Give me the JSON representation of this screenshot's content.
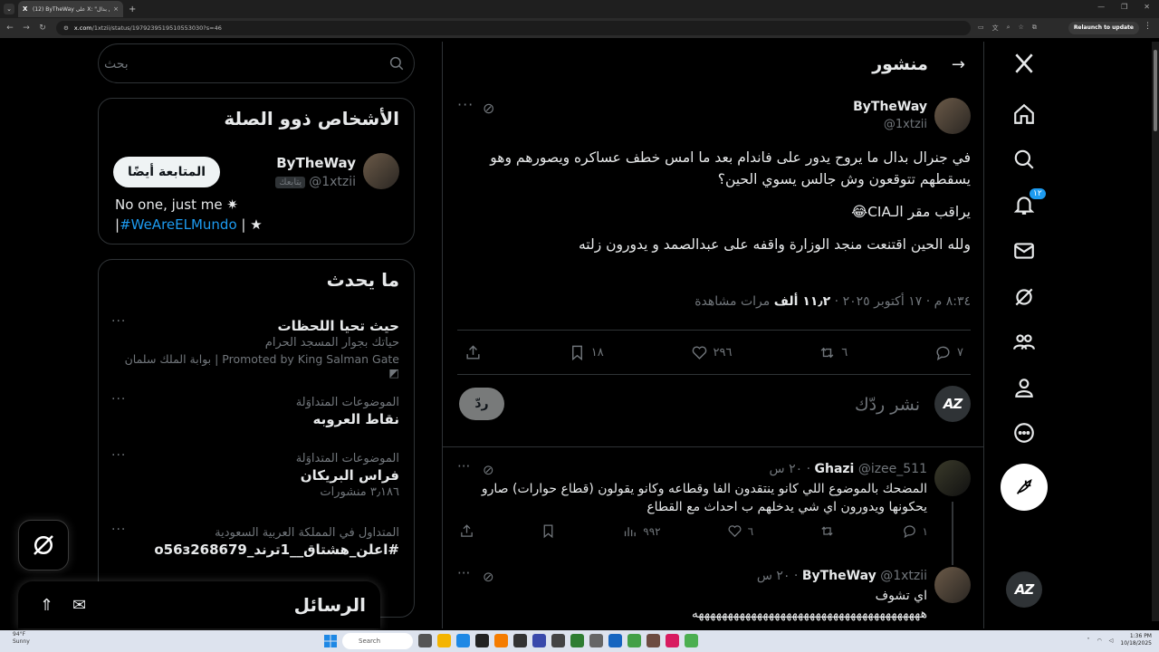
{
  "browser": {
    "tab_title": "(12) ByTheWay على X: \"في جنرال بدال...\"",
    "tab_close": "×",
    "new_tab": "+",
    "url_host": "x.com",
    "url_path": "/1xtzii/status/1979239519510553030?s=46",
    "relaunch_label": "Relaunch to update"
  },
  "left": {
    "search_placeholder": "بحث",
    "related": {
      "heading": "الأشخاص ذوو الصلة",
      "name": "ByTheWay",
      "handle": "@1xtzii",
      "follows_you": "يتابعك",
      "follow_button": "المتابعة أيضًا",
      "bio_prefix": "No one, just me ✷ |",
      "bio_hashtag": "#WeAreELMundo",
      "bio_suffix": " | ★"
    },
    "trends": {
      "heading": "ما يحدث",
      "items": [
        {
          "title": "حيث تحيا اللحظات",
          "sub": "حياتك بجوار المسجد الحرام",
          "promo": "بوابة الملك سلمان | Promoted by King Salman Gate"
        },
        {
          "context": "الموضوعات المتداوَلة",
          "title": "نقاط العروبه"
        },
        {
          "context": "الموضوعات المتداوَلة",
          "title": "فراس البريكان",
          "count": "٣٫١٨٦ منشورات"
        },
        {
          "context": "المتداول في المملكة العربية السعودية",
          "title": "#اعلن_هشتاق__1ترند_o56з268679"
        }
      ]
    },
    "messages_label": "الرسائل"
  },
  "center": {
    "header_title": "منشور",
    "post": {
      "name": "ByTheWay",
      "handle": "@1xtzii",
      "paragraph1": "في جنرال بدال ما يروح يدور على فاندام بعد ما امس خطف عساكره ويصورهم وهو يسقطهم  تتوقعون وش جالس يسوي الحين؟",
      "paragraph2": "يراقب مقر الـCIA😂",
      "paragraph3": "ولله الحين اقتنعت منجد الوزارة واقفه على عبدالصمد و يدورون زلته",
      "time": "٨:٣٤ م · ١٧ أكتوبر ٢٠٢٥ · ",
      "views_count": "١١٫٢ ألف",
      "views_label": " مرات مشاهدة",
      "replies": "٧",
      "reposts": "٦",
      "likes": "٢٩٦",
      "bookmarks": "١٨"
    },
    "reply_placeholder": "نشر ردّك",
    "reply_button": "ردّ",
    "replies": [
      {
        "name": "Ghazi",
        "handle": "@izee_511",
        "time": "٢٠ س",
        "text": "المضحك بالموضوع اللي كانو ينتقدون الفا وقطاعه وكانو يقولون (قطاع حوارات) صارو يحكونها ويدورون اي شي يدخلهم ب احداث مع القطاع",
        "replies": "١",
        "likes": "٦",
        "views": "٩٩٢"
      },
      {
        "name": "ByTheWay",
        "handle": "@1xtzii",
        "time": "٢٠ س",
        "text": "اي تشوف",
        "text2": "هههههههههههههههههههههههههههههههههههههههه"
      }
    ]
  },
  "nav": {
    "notifications_badge": "١٢"
  },
  "taskbar": {
    "weather_temp": "94°F",
    "weather_desc": "Sunny",
    "search_label": "Search",
    "time": "1:36 PM",
    "date": "10/18/2025"
  }
}
